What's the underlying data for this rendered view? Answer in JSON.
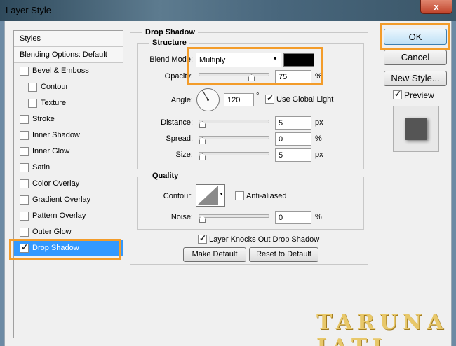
{
  "window": {
    "title": "Layer Style",
    "close": "x"
  },
  "styles_panel": {
    "header": "Styles",
    "blending": "Blending Options: Default",
    "items": [
      {
        "label": "Bevel & Emboss",
        "checked": false,
        "sub": false
      },
      {
        "label": "Contour",
        "checked": false,
        "sub": true
      },
      {
        "label": "Texture",
        "checked": false,
        "sub": true
      },
      {
        "label": "Stroke",
        "checked": false,
        "sub": false
      },
      {
        "label": "Inner Shadow",
        "checked": false,
        "sub": false
      },
      {
        "label": "Inner Glow",
        "checked": false,
        "sub": false
      },
      {
        "label": "Satin",
        "checked": false,
        "sub": false
      },
      {
        "label": "Color Overlay",
        "checked": false,
        "sub": false
      },
      {
        "label": "Gradient Overlay",
        "checked": false,
        "sub": false
      },
      {
        "label": "Pattern Overlay",
        "checked": false,
        "sub": false
      },
      {
        "label": "Outer Glow",
        "checked": false,
        "sub": false
      },
      {
        "label": "Drop Shadow",
        "checked": true,
        "sub": false,
        "selected": true
      }
    ]
  },
  "drop_shadow": {
    "title": "Drop Shadow",
    "structure": {
      "title": "Structure",
      "blend_mode_label": "Blend Mode:",
      "blend_mode": "Multiply",
      "shadow_color": "#000000",
      "opacity_label": "Opacity:",
      "opacity": "75",
      "opacity_unit": "%",
      "angle_label": "Angle:",
      "angle": "120",
      "angle_unit": "°",
      "global_light": "Use Global Light",
      "distance_label": "Distance:",
      "distance": "5",
      "distance_unit": "px",
      "spread_label": "Spread:",
      "spread": "0",
      "spread_unit": "%",
      "size_label": "Size:",
      "size": "5",
      "size_unit": "px"
    },
    "quality": {
      "title": "Quality",
      "contour_label": "Contour:",
      "anti_aliased": "Anti-aliased",
      "noise_label": "Noise:",
      "noise": "0",
      "noise_unit": "%"
    },
    "knockout": "Layer Knocks Out Drop Shadow",
    "make_default": "Make Default",
    "reset_default": "Reset to Default"
  },
  "right": {
    "ok": "OK",
    "cancel": "Cancel",
    "new_style": "New Style...",
    "preview": "Preview"
  },
  "watermark": "TARUNA JATI",
  "accent": "#f39c2a",
  "selection_color": "#3399ff"
}
